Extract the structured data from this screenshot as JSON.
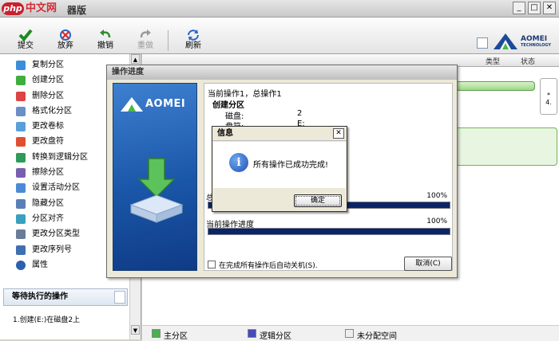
{
  "window": {
    "title": "器版",
    "watermark_brand": "php",
    "watermark_text": "中文网"
  },
  "toolbar": {
    "submit": "提交",
    "discard": "放弃",
    "undo": "撤销",
    "redo": "重做",
    "refresh": "刷新"
  },
  "logo": {
    "line1": "AOMEI",
    "line2": "TECHNOLOGY"
  },
  "operations": [
    "复制分区",
    "创建分区",
    "删除分区",
    "格式化分区",
    "更改卷标",
    "更改盘符",
    "转换到逻辑分区",
    "擦除分区",
    "设置活动分区",
    "隐藏分区",
    "分区对齐",
    "更改分区类型",
    "更改序列号",
    "属性"
  ],
  "pending": {
    "header": "等待执行的操作",
    "items": [
      "1.创建(E:)在磁盘2上"
    ]
  },
  "columns": {
    "type": "类型",
    "status": "状态"
  },
  "right_side": {
    "l1": "*",
    "l2": "4."
  },
  "legend": {
    "primary": "主分区",
    "logical": "逻辑分区",
    "unallocated": "未分配空间"
  },
  "progress": {
    "title": "操作进度",
    "brand": "AOMEI",
    "current": "当前操作1，总操作1",
    "op_name": "创建分区",
    "disk_label": "磁盘:",
    "disk_value": "2",
    "drive_label": "盘符:",
    "drive_value": "E:",
    "total_prefix": "总",
    "total_pct": "100%",
    "current_label": "当前操作进度",
    "current_pct": "100%",
    "shutdown_label": "在完成所有操作后自动关机(S).",
    "cancel": "取消(C)"
  },
  "message": {
    "title": "信息",
    "text": "所有操作已成功完成!",
    "ok": "确定",
    "close": "✕"
  }
}
